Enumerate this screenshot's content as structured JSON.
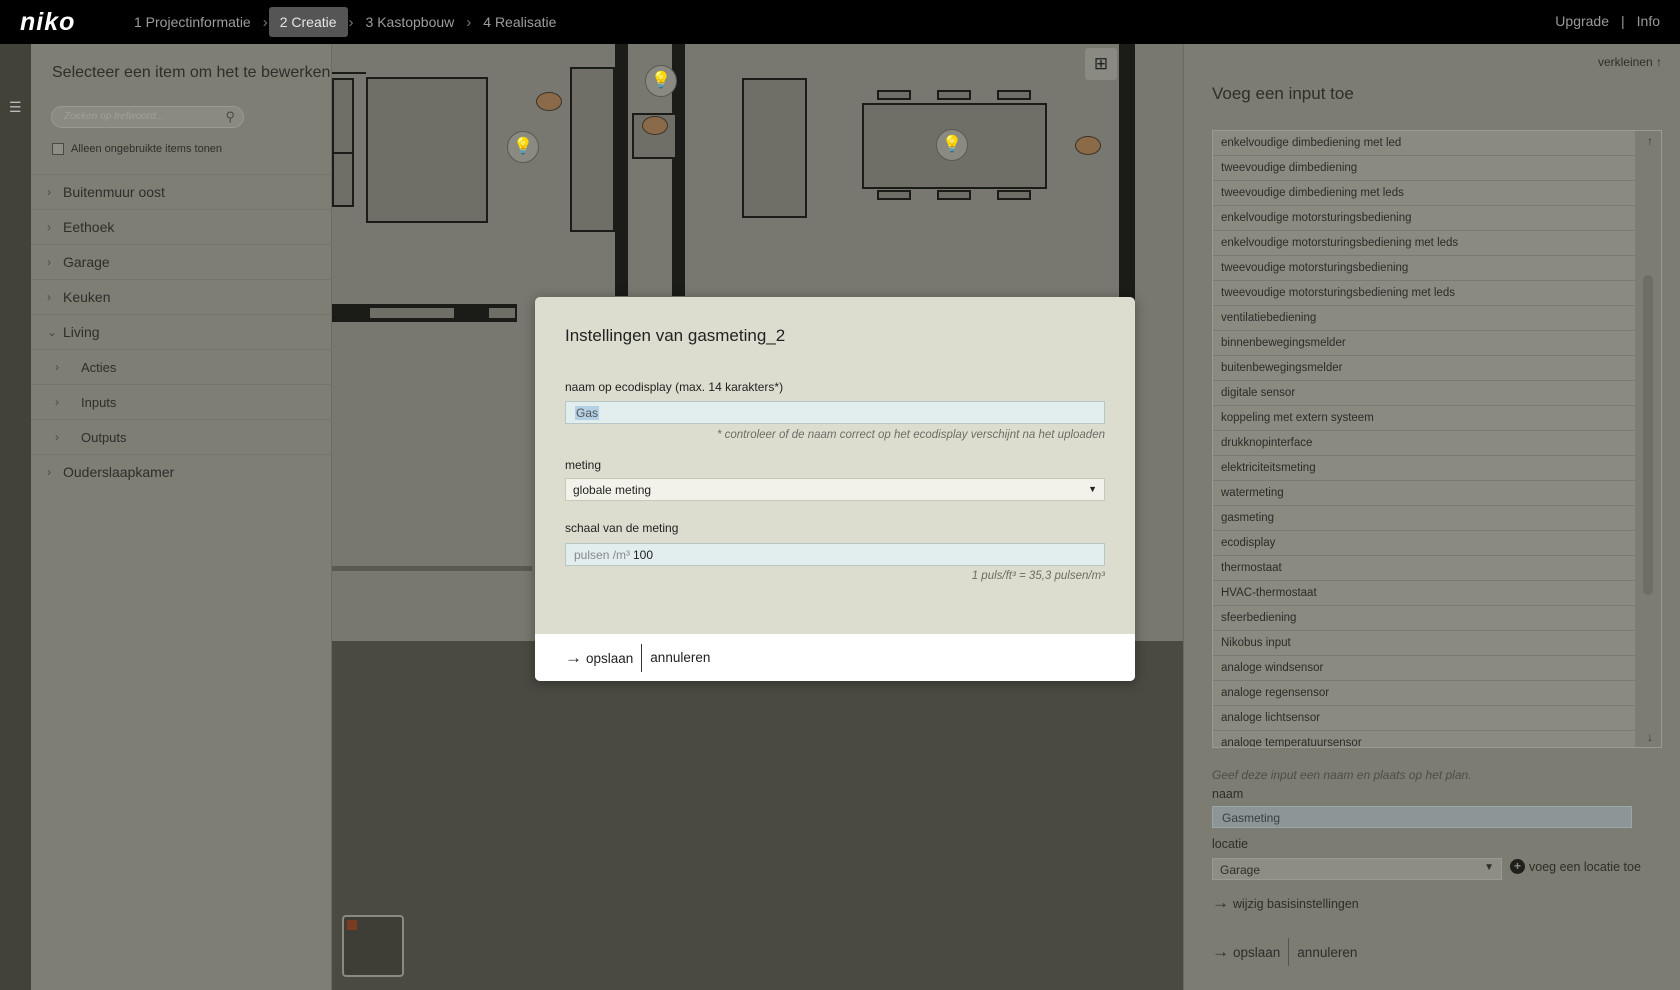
{
  "app": {
    "logo": "niko"
  },
  "steps": [
    {
      "label": "1 Projectinformatie"
    },
    {
      "label": "2 Creatie"
    },
    {
      "label": "3 Kastopbouw"
    },
    {
      "label": "4 Realisatie"
    }
  ],
  "topright": {
    "upgrade": "Upgrade",
    "sep": "|",
    "info": "Info"
  },
  "left_panel": {
    "title": "Selecteer een item om het te bewerken",
    "search_placeholder": "Zoeken op trefwoord...",
    "checkbox_label": "Alleen ongebruikte items tonen",
    "tree": [
      {
        "label": "Buitenmuur oost",
        "arrow": "›"
      },
      {
        "label": "Eethoek",
        "arrow": "›"
      },
      {
        "label": "Garage",
        "arrow": "›"
      },
      {
        "label": "Keuken",
        "arrow": "›"
      },
      {
        "label": "Living",
        "arrow": "⌄"
      },
      {
        "label": "Acties",
        "arrow": "›"
      },
      {
        "label": "Inputs",
        "arrow": "›"
      },
      {
        "label": "Outputs",
        "arrow": "›"
      },
      {
        "label": "Ouderslaapkamer",
        "arrow": "›"
      }
    ]
  },
  "right_panel": {
    "shrink": "verkleinen",
    "title": "Voeg een input toe",
    "inputs": [
      "enkelvoudige dimbediening met led",
      "tweevoudige dimbediening",
      "tweevoudige dimbediening met leds",
      "enkelvoudige motorsturingsbediening",
      "enkelvoudige motorsturingsbediening met leds",
      "tweevoudige motorsturingsbediening",
      "tweevoudige motorsturingsbediening met leds",
      "ventilatiebediening",
      "binnenbewegingsmelder",
      "buitenbewegingsmelder",
      "digitale sensor",
      "koppeling met extern systeem",
      "drukknopinterface",
      "elektriciteitsmeting",
      "watermeting",
      "gasmeting",
      "ecodisplay",
      "thermostaat",
      "HVAC-thermostaat",
      "sfeerbediening",
      "Nikobus input",
      "analoge windsensor",
      "analoge regensensor",
      "analoge lichtsensor",
      "analoge temperatuursensor"
    ],
    "hint": "Geef deze input een naam en plaats op het plan.",
    "name_label": "naam",
    "name_value": "Gasmeting",
    "location_label": "locatie",
    "location_value": "Garage",
    "add_location": "voeg een locatie toe",
    "basis": "wijzig basisinstellingen",
    "save": "opslaan",
    "cancel": "annuleren"
  },
  "modal": {
    "title": "Instellingen van gasmeting_2",
    "name_label": "naam op ecodisplay (max. 14 karakters*)",
    "name_value": "Gas",
    "name_note": "* controleer of de naam correct op het ecodisplay verschijnt na het uploaden",
    "metering_label": "meting",
    "metering_value": "globale meting",
    "scale_label": "schaal van de meting",
    "scale_unit": "pulsen /m³",
    "scale_value": "100",
    "scale_note": "1 puls/ft³ = 35,3 pulsen/m³",
    "save": "opslaan",
    "cancel": "annuleren"
  }
}
